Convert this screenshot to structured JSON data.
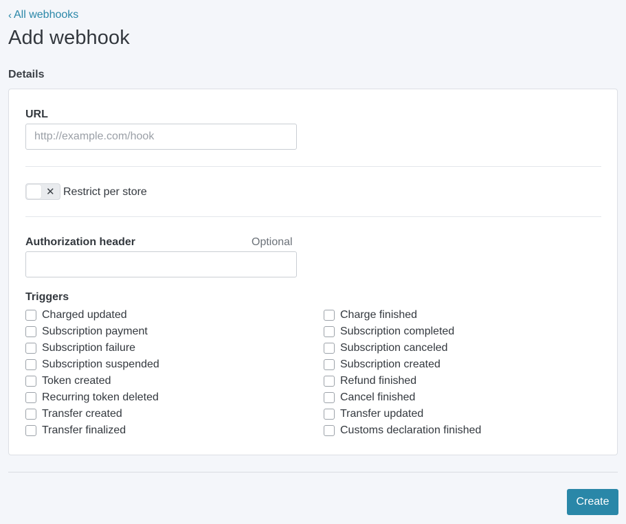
{
  "header": {
    "back_chevron": "‹",
    "back_label": "All webhooks",
    "title": "Add webhook"
  },
  "details": {
    "section_label": "Details",
    "url": {
      "label": "URL",
      "placeholder": "http://example.com/hook",
      "value": ""
    },
    "restrict_toggle": {
      "label": "Restrict per store",
      "state": "off",
      "icon": "x-icon"
    },
    "authorization": {
      "label": "Authorization header",
      "optional_label": "Optional",
      "value": ""
    },
    "triggers": {
      "title": "Triggers",
      "left": [
        "Charged updated",
        "Subscription payment",
        "Subscription failure",
        "Subscription suspended",
        "Token created",
        "Recurring token deleted",
        "Transfer created",
        "Transfer finalized"
      ],
      "right": [
        "Charge finished",
        "Subscription completed",
        "Subscription canceled",
        "Subscription created",
        "Refund finished",
        "Cancel finished",
        "Transfer updated",
        "Customs declaration finished"
      ]
    }
  },
  "footer": {
    "create_label": "Create"
  },
  "colors": {
    "accent": "#2a87a8",
    "background": "#f4f6fa",
    "card": "#ffffff"
  }
}
